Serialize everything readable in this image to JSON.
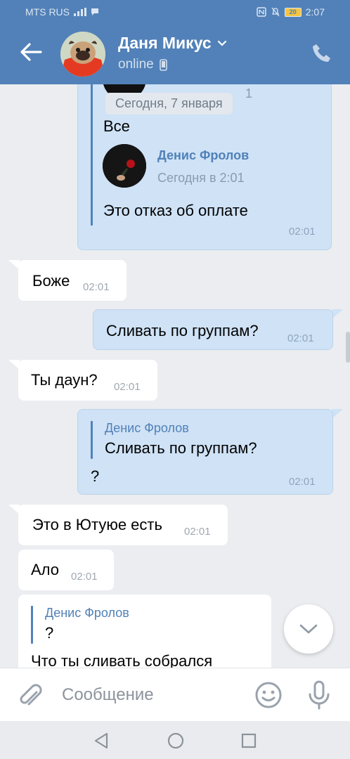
{
  "status_bar": {
    "carrier": "MTS RUS",
    "battery": "20",
    "time": "2:07"
  },
  "header": {
    "name": "Даня Микус",
    "status": "online"
  },
  "messages": [
    {
      "id": "m0",
      "quote_date_pill": "Сегодня, 7 января",
      "partial_time": "1",
      "text_top": "Все",
      "quote_name": "Денис Фролов",
      "quote_date": "Сегодня в 2:01",
      "text": "Это отказ об оплате",
      "time": "02:01"
    },
    {
      "id": "m1",
      "text": "Боже",
      "time": "02:01"
    },
    {
      "id": "m2",
      "text": "Сливать по группам?",
      "time": "02:01"
    },
    {
      "id": "m3",
      "text": "Ты даун?",
      "time": "02:01"
    },
    {
      "id": "m4",
      "quote_name": "Денис Фролов",
      "quote_text": "Сливать по группам?",
      "text": "?",
      "time": "02:01"
    },
    {
      "id": "m5",
      "text": "Это в Ютуюе есть",
      "time": "02:01"
    },
    {
      "id": "m6",
      "text": "Ало",
      "time": "02:01"
    },
    {
      "id": "m7",
      "quote_name": "Денис Фролов",
      "quote_text": "?",
      "text": "Что ты сливать собрался"
    }
  ],
  "composer": {
    "placeholder": "Сообщение"
  },
  "icons": {
    "back": "arrow-left-icon",
    "call": "phone-icon",
    "attach": "paperclip-icon",
    "emoji": "smile-icon",
    "voice": "microphone-icon",
    "scroll_down": "chevron-down-icon"
  },
  "colors": {
    "header": "#5181b8",
    "outgoing_bubble": "#cfe2f6",
    "incoming_bubble": "#ffffff",
    "chat_background": "#ebedf0",
    "link_blue": "#5181b8"
  }
}
